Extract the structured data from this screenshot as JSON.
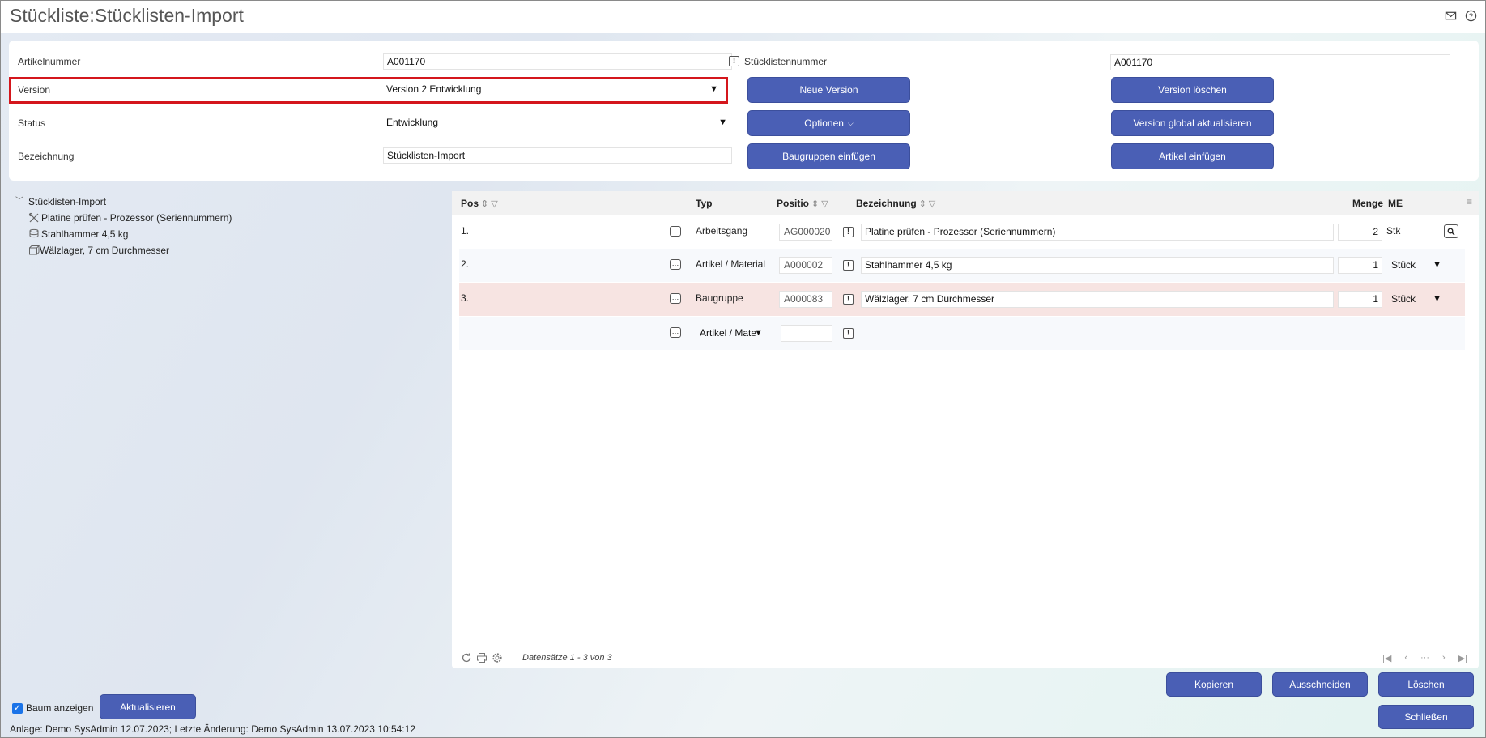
{
  "window": {
    "title": "Stückliste:Stücklisten-Import"
  },
  "form": {
    "artikelnummer_label": "Artikelnummer",
    "artikelnummer_value": "A001170",
    "stuecklistennummer_label": "Stücklistennummer",
    "stuecklistennummer_value": "A001170",
    "version_label": "Version",
    "version_value": "Version 2 Entwicklung",
    "status_label": "Status",
    "status_value": "Entwicklung",
    "bezeichnung_label": "Bezeichnung",
    "bezeichnung_value": "Stücklisten-Import",
    "buttons": {
      "neue_version": "Neue Version",
      "optionen": "Optionen",
      "baugruppen_einfuegen": "Baugruppen einfügen",
      "version_loeschen": "Version löschen",
      "version_global": "Version global aktualisieren",
      "artikel_einfuegen": "Artikel einfügen"
    }
  },
  "tree": {
    "root": "Stücklisten-Import",
    "children": [
      {
        "label": "Platine prüfen - Prozessor (Seriennummern)",
        "icon": "tools-icon"
      },
      {
        "label": "Stahlhammer 4,5 kg",
        "icon": "stack-icon"
      },
      {
        "label": "Wälzlager, 7 cm Durchmesser",
        "icon": "box-icon"
      }
    ]
  },
  "grid": {
    "headers": {
      "pos": "Pos",
      "typ": "Typ",
      "position": "Positio",
      "bezeichnung": "Bezeichnung",
      "menge": "Menge",
      "me": "ME"
    },
    "rows": [
      {
        "pos": "1.",
        "typ": "Arbeitsgang",
        "position": "AG000020",
        "bezeichnung": "Platine prüfen - Prozessor (Seriennummern)",
        "menge": "2",
        "me": "Stk"
      },
      {
        "pos": "2.",
        "typ": "Artikel / Material",
        "position": "A000002",
        "bezeichnung": "Stahlhammer 4,5 kg",
        "menge": "1",
        "me": "Stück"
      },
      {
        "pos": "3.",
        "typ": "Baugruppe",
        "position": "A000083",
        "bezeichnung": "Wälzlager, 7 cm Durchmesser",
        "menge": "1",
        "me": "Stück"
      }
    ],
    "new_row_type": "Artikel / Mate",
    "footer_count": "Datensätze 1 - 3 von 3",
    "highlight_color": "#f7e4e2"
  },
  "actions": {
    "kopieren": "Kopieren",
    "ausschneiden": "Ausschneiden",
    "loeschen": "Löschen",
    "schliessen": "Schließen",
    "aktualisieren": "Aktualisieren",
    "baum_anzeigen": "Baum anzeigen"
  },
  "status_text": "Anlage: Demo SysAdmin 12.07.2023; Letzte Änderung: Demo SysAdmin 13.07.2023 10:54:12",
  "colors": {
    "button": "#4a5fb5",
    "highlight_border": "#d4161c"
  }
}
